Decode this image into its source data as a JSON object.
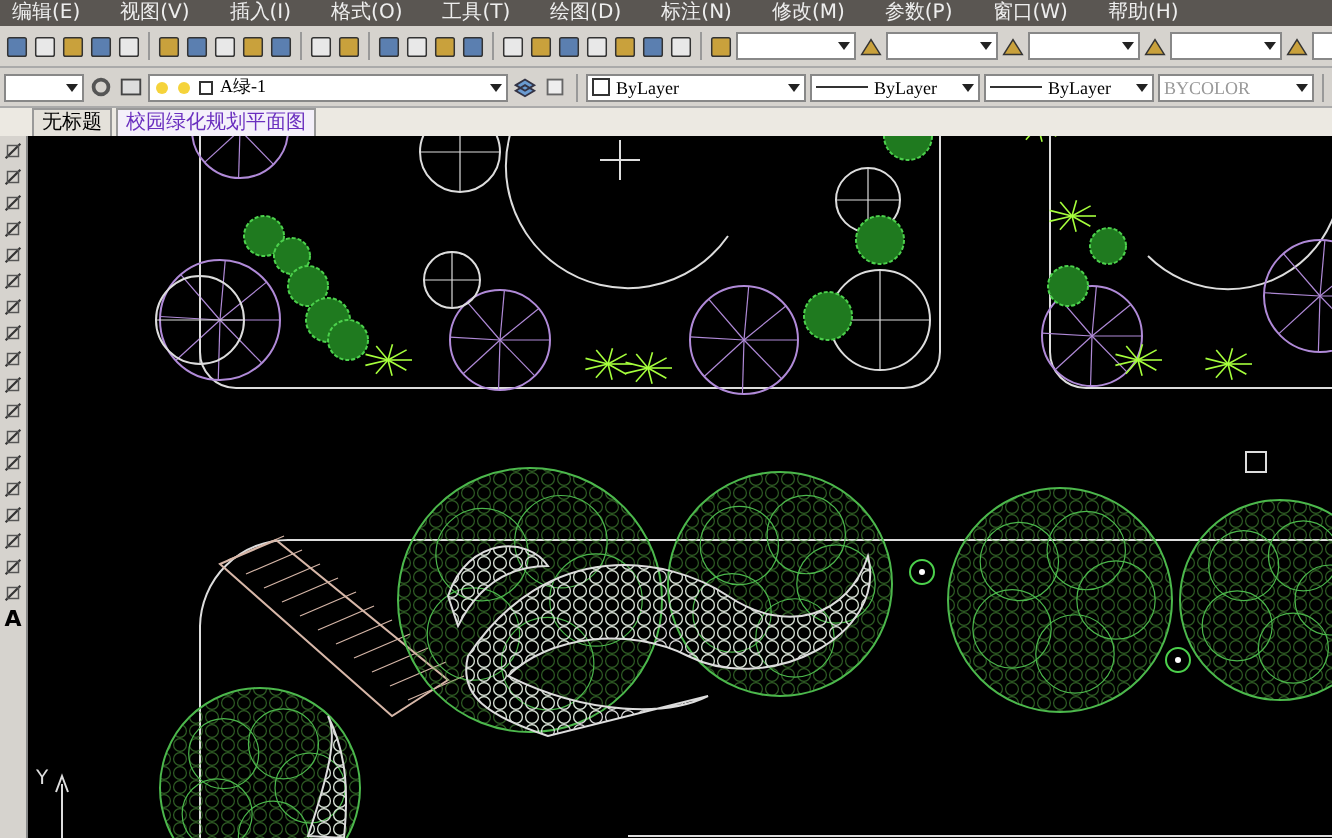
{
  "menu": [
    {
      "label": "编辑(E)"
    },
    {
      "label": "视图(V)"
    },
    {
      "label": "插入(I)"
    },
    {
      "label": "格式(O)"
    },
    {
      "label": "工具(T)"
    },
    {
      "label": "绘图(D)"
    },
    {
      "label": "标注(N)"
    },
    {
      "label": "修改(M)"
    },
    {
      "label": "参数(P)"
    },
    {
      "label": "窗口(W)"
    },
    {
      "label": "帮助(H)"
    }
  ],
  "draw_toolbar": {
    "text_tool": "A"
  },
  "properties": {
    "layer": "A绿-1",
    "color_setting": "ByLayer",
    "linetype": "ByLayer",
    "lineweight": "ByLayer",
    "plot_style": {
      "value": "BYCOLOR",
      "disabled": true
    }
  },
  "tabs": [
    {
      "label": "无标题",
      "selected": false
    },
    {
      "label": "校园绿化规划平面图",
      "selected": true
    }
  ],
  "ucs": {
    "axis_label": "Y"
  }
}
